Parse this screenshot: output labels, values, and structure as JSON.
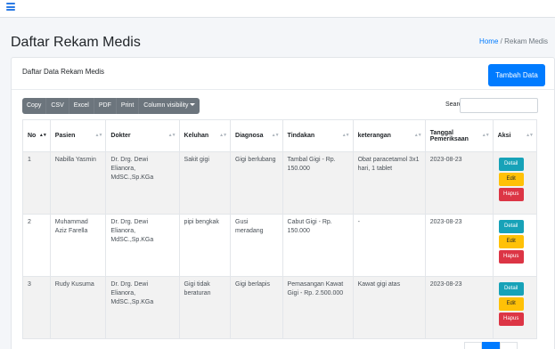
{
  "nav": {
    "menu_icon": "hamburger-icon"
  },
  "page": {
    "title": "Daftar Rekam Medis",
    "breadcrumb": {
      "home": "Home",
      "separator": "/",
      "current": "Rekam Medis"
    }
  },
  "card": {
    "title": "Daftar Data Rekam Medis",
    "add_button": "Tambah Data"
  },
  "export_buttons": [
    "Copy",
    "CSV",
    "Excel",
    "PDF",
    "Print",
    "Column visibility"
  ],
  "search": {
    "label": "Search:",
    "value": ""
  },
  "table": {
    "headers": [
      "No",
      "Pasien",
      "Dokter",
      "Keluhan",
      "Diagnosa",
      "Tindakan",
      "keterangan",
      "Tanggal Pemeriksaan",
      "Aksi"
    ],
    "rows": [
      {
        "no": "1",
        "pasien": "Nabilla Yasmin",
        "dokter": "Dr. Drg. Dewi Elianora, MdSC.,Sp.KGa",
        "keluhan": "Sakit gigi",
        "diagnosa": "Gigi berlubang",
        "tindakan": "Tambal Gigi - Rp. 150.000",
        "keterangan": "Obat paracetamol 3x1 hari, 1 tablet",
        "tanggal": "2023-08-23"
      },
      {
        "no": "2",
        "pasien": "Muhammad Aziz Farella",
        "dokter": "Dr. Drg. Dewi Elianora, MdSC.,Sp.KGa",
        "keluhan": "pipi bengkak",
        "diagnosa": "Gusi meradang",
        "tindakan": "Cabut Gigi - Rp. 150.000",
        "keterangan": "-",
        "tanggal": "2023-08-23"
      },
      {
        "no": "3",
        "pasien": "Rudy Kusuma",
        "dokter": "Dr. Drg. Dewi Elianora, MdSC.,Sp.KGa",
        "keluhan": "Gigi tidak beraturan",
        "diagnosa": "Gigi berlapis",
        "tindakan": "Pemasangan Kawat Gigi - Rp. 2.500.000",
        "keterangan": "Kawat gigi atas",
        "tanggal": "2023-08-23"
      }
    ],
    "actions": {
      "detail": "Detail",
      "edit": "Edit",
      "hapus": "Hapus"
    }
  },
  "colors": {
    "primary": "#007bff",
    "info": "#17a2b8",
    "warning": "#ffc107",
    "danger": "#dc3545",
    "secondary": "#6c757d"
  }
}
